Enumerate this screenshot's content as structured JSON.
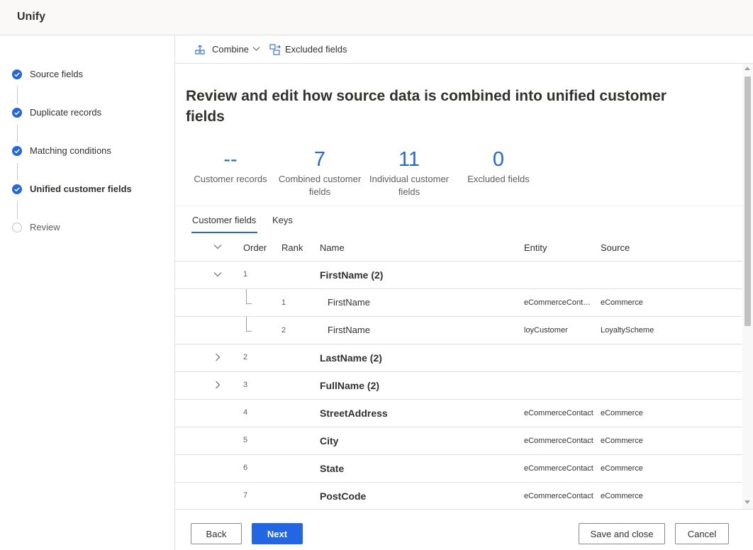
{
  "app": {
    "title": "Unify"
  },
  "steps": [
    {
      "label": "Source fields",
      "state": "done"
    },
    {
      "label": "Duplicate records",
      "state": "done"
    },
    {
      "label": "Matching conditions",
      "state": "done"
    },
    {
      "label": "Unified customer fields",
      "state": "current"
    },
    {
      "label": "Review",
      "state": "todo"
    }
  ],
  "commands": {
    "combine": "Combine",
    "excluded": "Excluded fields"
  },
  "page": {
    "headline": "Review and edit how source data is combined into unified customer fields"
  },
  "kpis": [
    {
      "value": "--",
      "caption": "Customer records"
    },
    {
      "value": "7",
      "caption": "Combined customer fields"
    },
    {
      "value": "11",
      "caption": "Individual customer fields"
    },
    {
      "value": "0",
      "caption": "Excluded fields"
    }
  ],
  "tabs": [
    {
      "label": "Customer fields",
      "selected": true
    },
    {
      "label": "Keys",
      "selected": false
    }
  ],
  "table": {
    "headers": {
      "order": "Order",
      "rank": "Rank",
      "name": "Name",
      "entity": "Entity",
      "source": "Source"
    },
    "rows": [
      {
        "order": "1",
        "name": "FirstName (2)",
        "expand": "expanded",
        "entity": "",
        "source": "",
        "children": [
          {
            "rank": "1",
            "name": "FirstName",
            "entity": "eCommerceContacts",
            "source": "eCommerce"
          },
          {
            "rank": "2",
            "name": "FirstName",
            "entity": "loyCustomer",
            "source": "LoyaltyScheme"
          }
        ]
      },
      {
        "order": "2",
        "name": "LastName (2)",
        "expand": "collapsed",
        "entity": "",
        "source": ""
      },
      {
        "order": "3",
        "name": "FullName (2)",
        "expand": "collapsed",
        "entity": "",
        "source": ""
      },
      {
        "order": "4",
        "name": "StreetAddress",
        "expand": "none",
        "entity": "eCommerceContacts",
        "source": "eCommerce"
      },
      {
        "order": "5",
        "name": "City",
        "expand": "none",
        "entity": "eCommerceContacts",
        "source": "eCommerce"
      },
      {
        "order": "6",
        "name": "State",
        "expand": "none",
        "entity": "eCommerceContacts",
        "source": "eCommerce"
      },
      {
        "order": "7",
        "name": "PostCode",
        "expand": "none",
        "entity": "eCommerceContacts",
        "source": "eCommerce"
      }
    ]
  },
  "footer": {
    "back": "Back",
    "next": "Next",
    "save_close": "Save and close",
    "cancel": "Cancel"
  },
  "colors": {
    "accent": "#2266e3",
    "border": "#e1dfdd",
    "topbar": "#faf9f8"
  }
}
